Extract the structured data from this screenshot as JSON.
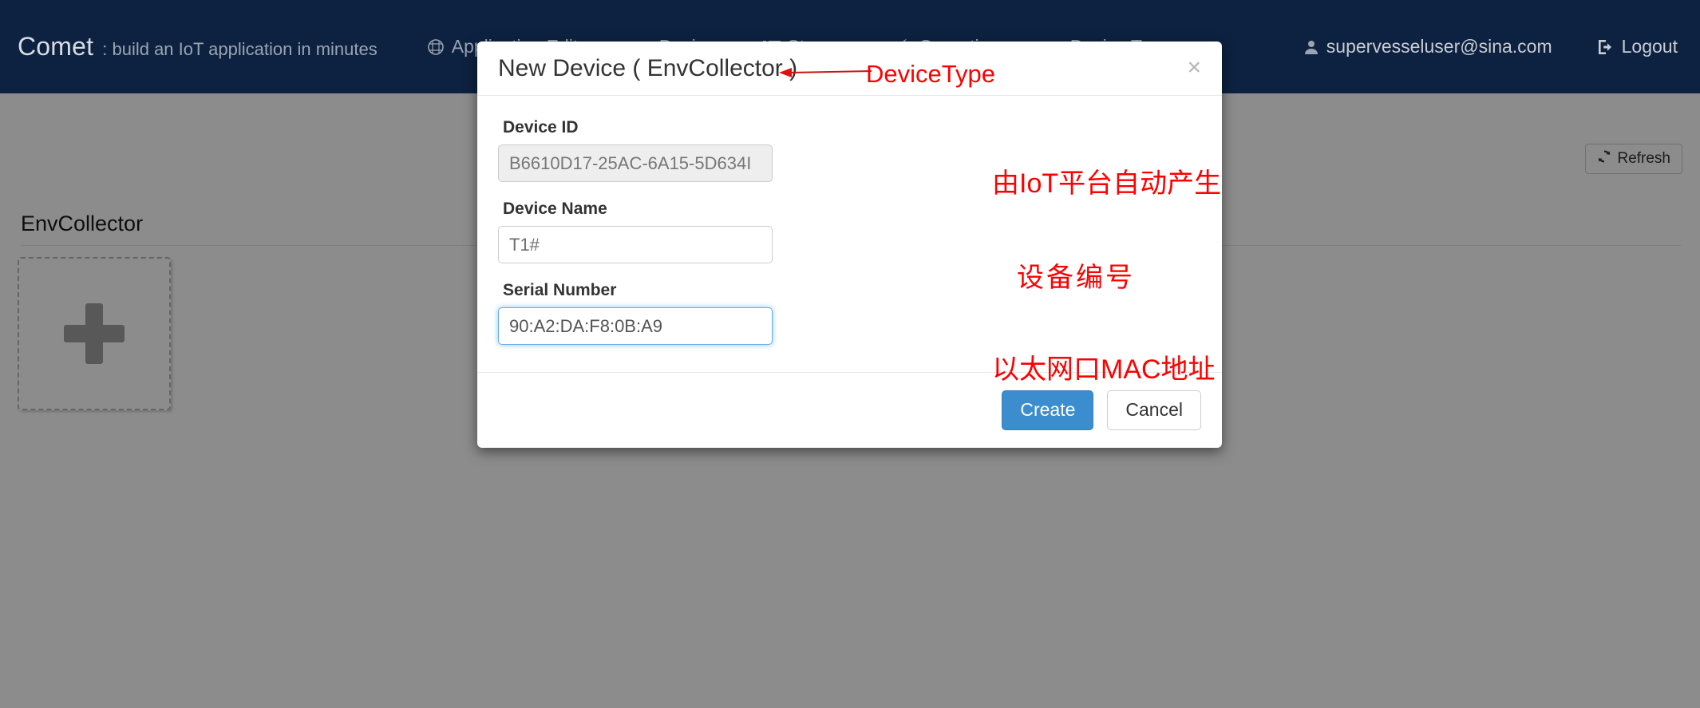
{
  "navbar": {
    "brand_name": "Comet",
    "brand_tagline": ": build an IoT application in minutes",
    "links": [
      {
        "label": "Application Editor",
        "icon": "network-nodes-icon"
      },
      {
        "label": "Devices",
        "icon": "tag-icon"
      },
      {
        "label": "Streams",
        "icon": "list-icon"
      },
      {
        "label": "Operations",
        "icon": "wrench-icon"
      },
      {
        "label": "Device Type",
        "icon": "device-icon"
      }
    ],
    "user_email": "supervesseluser@sina.com",
    "user_icon": "user-icon",
    "logout_label": "Logout",
    "logout_icon": "sign-out-icon",
    "background_color": "#0d2240"
  },
  "page": {
    "refresh_label": "Refresh",
    "refresh_icon": "refresh-icon",
    "group_title": "EnvCollector",
    "add_card_icon": "plus-icon"
  },
  "modal": {
    "title": "New Device ( EnvCollector )",
    "close_icon": "close-icon",
    "fields": [
      {
        "label": "Device ID",
        "value": "B6610D17-25AC-6A15-5D634I",
        "placeholder": "",
        "state": "disabled"
      },
      {
        "label": "Device Name",
        "value": "T1#",
        "placeholder": "",
        "state": "normal"
      },
      {
        "label": "Serial Number",
        "value": "90:A2:DA:F8:0B:A9",
        "placeholder": "",
        "state": "focused"
      }
    ],
    "create_label": "Create",
    "cancel_label": "Cancel",
    "primary_color": "#3c8dcd"
  },
  "annotations": {
    "color": "#fe0000",
    "device_type": "DeviceType",
    "device_id": "由IoT平台自动产生",
    "device_name": "设备编号",
    "serial_number": "以太网口MAC地址"
  }
}
